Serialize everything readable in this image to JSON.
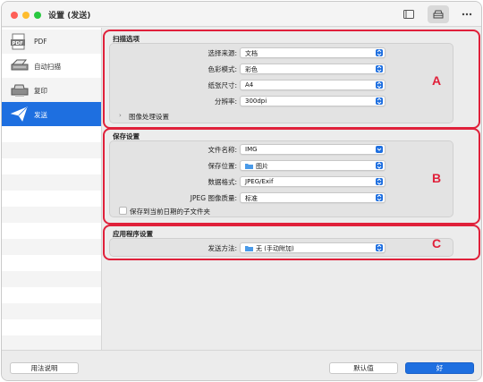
{
  "window": {
    "title": "设置 (发送)"
  },
  "toolbar": {
    "device_icon": "device-icon",
    "scan_icon": "scanner-icon",
    "more_icon": "more-icon"
  },
  "sidebar": {
    "items": [
      {
        "label": "PDF",
        "icon": "pdf-icon"
      },
      {
        "label": "自动扫描",
        "icon": "scanner-icon"
      },
      {
        "label": "复印",
        "icon": "copier-icon"
      },
      {
        "label": "发送",
        "icon": "paper-plane-icon",
        "active": true
      }
    ]
  },
  "scan_options": {
    "title": "扫描选项",
    "source_label": "选择来源:",
    "source_value": "文档",
    "color_label": "色彩模式:",
    "color_value": "彩色",
    "paper_label": "纸张尺寸:",
    "paper_value": "A4",
    "resolution_label": "分辨率:",
    "resolution_value": "300dpi",
    "image_processing_label": "图像处理设置"
  },
  "save_settings": {
    "title": "保存设置",
    "filename_label": "文件名称:",
    "filename_value": "IMG",
    "location_label": "保存位置:",
    "location_value": "图片",
    "format_label": "数据格式:",
    "format_value": "JPEG/Exif",
    "quality_label": "JPEG 图像质量:",
    "quality_value": "标准",
    "subfolder_label": "保存到当前日期的子文件夹"
  },
  "app_settings": {
    "title": "应用程序设置",
    "send_label": "发送方法:",
    "send_value": "无 (手动附加)"
  },
  "annotations": {
    "a": "A",
    "b": "B",
    "c": "C",
    "color": "#e0203a"
  },
  "bottom": {
    "help_label": "用法说明",
    "defaults_label": "默认值",
    "ok_label": "好"
  },
  "colors": {
    "accent": "#1e6fe0"
  }
}
